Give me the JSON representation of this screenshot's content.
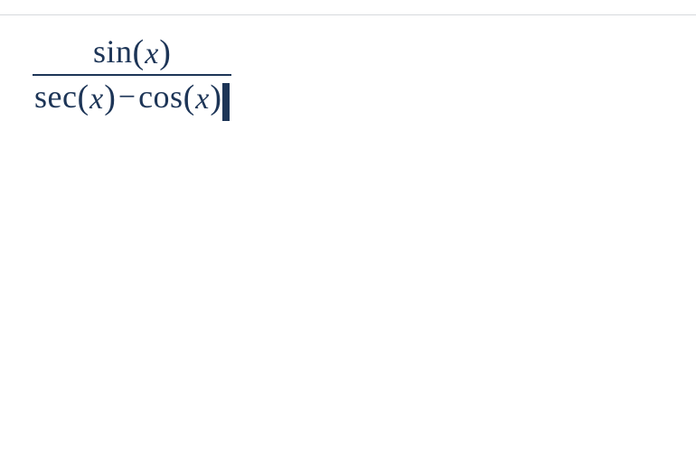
{
  "formula": {
    "numerator": {
      "fn": "sin",
      "open": "(",
      "var": "x",
      "close": ")"
    },
    "denominator": {
      "term1": {
        "fn": "sec",
        "open": "(",
        "var": "x",
        "close": ")"
      },
      "operator": "−",
      "term2": {
        "fn": "cos",
        "open": "(",
        "var": "x",
        "close": ")"
      }
    }
  }
}
